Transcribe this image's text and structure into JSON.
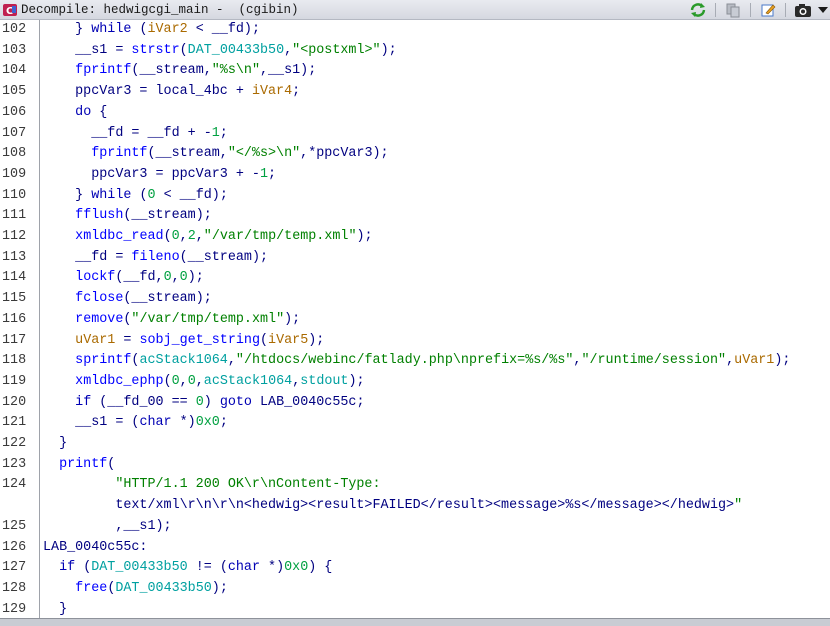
{
  "window": {
    "title": "Decompile: hedwigcgi_main -  (cgibin)"
  },
  "toolbar": {
    "icons": [
      "refresh-icon",
      "copy-icon",
      "edit-icon",
      "camera-icon",
      "dropdown-icon"
    ]
  },
  "code_lines": [
    {
      "n": "102",
      "t": "    } while (iVar2 < __fd);"
    },
    {
      "n": "103",
      "t": "    __s1 = strstr(DAT_00433b50,\"<postxml>\");"
    },
    {
      "n": "104",
      "t": "    fprintf(__stream,\"%s\\n\",__s1);"
    },
    {
      "n": "105",
      "t": "    ppcVar3 = local_4bc + iVar4;"
    },
    {
      "n": "106",
      "t": "    do {"
    },
    {
      "n": "107",
      "t": "      __fd = __fd + -1;"
    },
    {
      "n": "108",
      "t": "      fprintf(__stream,\"</%s>\\n\",*ppcVar3);"
    },
    {
      "n": "109",
      "t": "      ppcVar3 = ppcVar3 + -1;"
    },
    {
      "n": "110",
      "t": "    } while (0 < __fd);"
    },
    {
      "n": "111",
      "t": "    fflush(__stream);"
    },
    {
      "n": "112",
      "t": "    xmldbc_read(0,2,\"/var/tmp/temp.xml\");"
    },
    {
      "n": "113",
      "t": "    __fd = fileno(__stream);"
    },
    {
      "n": "114",
      "t": "    lockf(__fd,0,0);"
    },
    {
      "n": "115",
      "t": "    fclose(__stream);"
    },
    {
      "n": "116",
      "t": "    remove(\"/var/tmp/temp.xml\");"
    },
    {
      "n": "117",
      "t": "    uVar1 = sobj_get_string(iVar5);"
    },
    {
      "n": "118",
      "t": "    sprintf(acStack1064,\"/htdocs/webinc/fatlady.php\\nprefix=%s/%s\",\"/runtime/session\",uVar1);"
    },
    {
      "n": "119",
      "t": "    xmldbc_ephp(0,0,acStack1064,stdout);"
    },
    {
      "n": "120",
      "t": "    if (__fd_00 == 0) goto LAB_0040c55c;"
    },
    {
      "n": "121",
      "t": "    __s1 = (char *)0x0;"
    },
    {
      "n": "122",
      "t": "  }"
    },
    {
      "n": "123",
      "t": "  printf("
    },
    {
      "n": "124",
      "t": "         \"HTTP/1.1 200 OK\\r\\nContent-Type:"
    },
    {
      "n": "",
      "t": "         text/xml\\r\\n\\r\\n<hedwig><result>FAILED</result><message>%s</message></hedwig>\""
    },
    {
      "n": "125",
      "t": "         ,__s1);"
    },
    {
      "n": "126",
      "t": "LAB_0040c55c:"
    },
    {
      "n": "127",
      "t": "  if (DAT_00433b50 != (char *)0x0) {"
    },
    {
      "n": "128",
      "t": "    free(DAT_00433b50);"
    },
    {
      "n": "129",
      "t": "  }"
    }
  ]
}
